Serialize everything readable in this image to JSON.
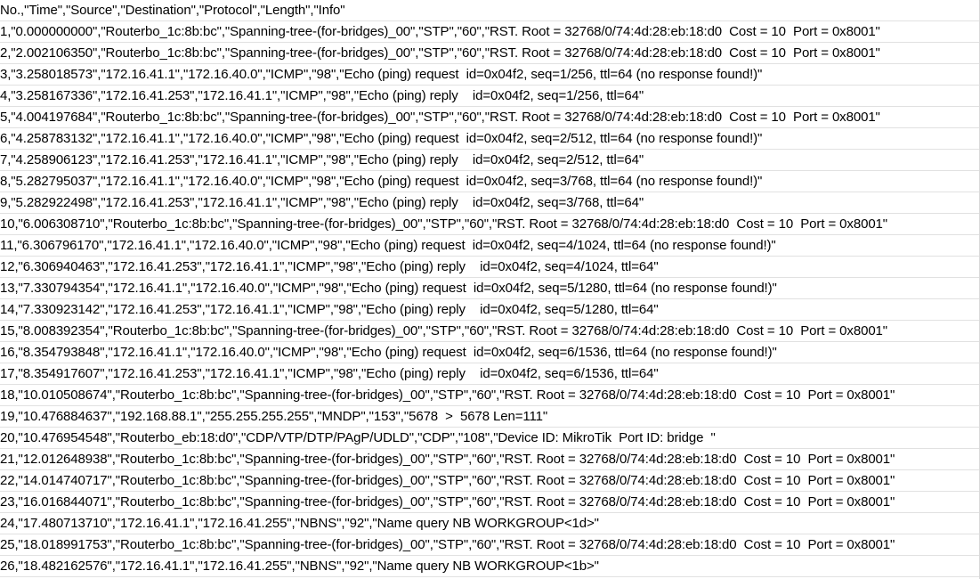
{
  "sheet": {
    "rows": [
      "No.,\"Time\",\"Source\",\"Destination\",\"Protocol\",\"Length\",\"Info\"",
      "1,\"0.000000000\",\"Routerbo_1c:8b:bc\",\"Spanning-tree-(for-bridges)_00\",\"STP\",\"60\",\"RST. Root = 32768/0/74:4d:28:eb:18:d0  Cost = 10  Port = 0x8001\"",
      "2,\"2.002106350\",\"Routerbo_1c:8b:bc\",\"Spanning-tree-(for-bridges)_00\",\"STP\",\"60\",\"RST. Root = 32768/0/74:4d:28:eb:18:d0  Cost = 10  Port = 0x8001\"",
      "3,\"3.258018573\",\"172.16.41.1\",\"172.16.40.0\",\"ICMP\",\"98\",\"Echo (ping) request  id=0x04f2, seq=1/256, ttl=64 (no response found!)\"",
      "4,\"3.258167336\",\"172.16.41.253\",\"172.16.41.1\",\"ICMP\",\"98\",\"Echo (ping) reply    id=0x04f2, seq=1/256, ttl=64\"",
      "5,\"4.004197684\",\"Routerbo_1c:8b:bc\",\"Spanning-tree-(for-bridges)_00\",\"STP\",\"60\",\"RST. Root = 32768/0/74:4d:28:eb:18:d0  Cost = 10  Port = 0x8001\"",
      "6,\"4.258783132\",\"172.16.41.1\",\"172.16.40.0\",\"ICMP\",\"98\",\"Echo (ping) request  id=0x04f2, seq=2/512, ttl=64 (no response found!)\"",
      "7,\"4.258906123\",\"172.16.41.253\",\"172.16.41.1\",\"ICMP\",\"98\",\"Echo (ping) reply    id=0x04f2, seq=2/512, ttl=64\"",
      "8,\"5.282795037\",\"172.16.41.1\",\"172.16.40.0\",\"ICMP\",\"98\",\"Echo (ping) request  id=0x04f2, seq=3/768, ttl=64 (no response found!)\"",
      "9,\"5.282922498\",\"172.16.41.253\",\"172.16.41.1\",\"ICMP\",\"98\",\"Echo (ping) reply    id=0x04f2, seq=3/768, ttl=64\"",
      "10,\"6.006308710\",\"Routerbo_1c:8b:bc\",\"Spanning-tree-(for-bridges)_00\",\"STP\",\"60\",\"RST. Root = 32768/0/74:4d:28:eb:18:d0  Cost = 10  Port = 0x8001\"",
      "11,\"6.306796170\",\"172.16.41.1\",\"172.16.40.0\",\"ICMP\",\"98\",\"Echo (ping) request  id=0x04f2, seq=4/1024, ttl=64 (no response found!)\"",
      "12,\"6.306940463\",\"172.16.41.253\",\"172.16.41.1\",\"ICMP\",\"98\",\"Echo (ping) reply    id=0x04f2, seq=4/1024, ttl=64\"",
      "13,\"7.330794354\",\"172.16.41.1\",\"172.16.40.0\",\"ICMP\",\"98\",\"Echo (ping) request  id=0x04f2, seq=5/1280, ttl=64 (no response found!)\"",
      "14,\"7.330923142\",\"172.16.41.253\",\"172.16.41.1\",\"ICMP\",\"98\",\"Echo (ping) reply    id=0x04f2, seq=5/1280, ttl=64\"",
      "15,\"8.008392354\",\"Routerbo_1c:8b:bc\",\"Spanning-tree-(for-bridges)_00\",\"STP\",\"60\",\"RST. Root = 32768/0/74:4d:28:eb:18:d0  Cost = 10  Port = 0x8001\"",
      "16,\"8.354793848\",\"172.16.41.1\",\"172.16.40.0\",\"ICMP\",\"98\",\"Echo (ping) request  id=0x04f2, seq=6/1536, ttl=64 (no response found!)\"",
      "17,\"8.354917607\",\"172.16.41.253\",\"172.16.41.1\",\"ICMP\",\"98\",\"Echo (ping) reply    id=0x04f2, seq=6/1536, ttl=64\"",
      "18,\"10.010508674\",\"Routerbo_1c:8b:bc\",\"Spanning-tree-(for-bridges)_00\",\"STP\",\"60\",\"RST. Root = 32768/0/74:4d:28:eb:18:d0  Cost = 10  Port = 0x8001\"",
      "19,\"10.476884637\",\"192.168.88.1\",\"255.255.255.255\",\"MNDP\",\"153\",\"5678  >  5678 Len=111\"",
      "20,\"10.476954548\",\"Routerbo_eb:18:d0\",\"CDP/VTP/DTP/PAgP/UDLD\",\"CDP\",\"108\",\"Device ID: MikroTik  Port ID: bridge  \"",
      "21,\"12.012648938\",\"Routerbo_1c:8b:bc\",\"Spanning-tree-(for-bridges)_00\",\"STP\",\"60\",\"RST. Root = 32768/0/74:4d:28:eb:18:d0  Cost = 10  Port = 0x8001\"",
      "22,\"14.014740717\",\"Routerbo_1c:8b:bc\",\"Spanning-tree-(for-bridges)_00\",\"STP\",\"60\",\"RST. Root = 32768/0/74:4d:28:eb:18:d0  Cost = 10  Port = 0x8001\"",
      "23,\"16.016844071\",\"Routerbo_1c:8b:bc\",\"Spanning-tree-(for-bridges)_00\",\"STP\",\"60\",\"RST. Root = 32768/0/74:4d:28:eb:18:d0  Cost = 10  Port = 0x8001\"",
      "24,\"17.480713710\",\"172.16.41.1\",\"172.16.41.255\",\"NBNS\",\"92\",\"Name query NB WORKGROUP<1d>\"",
      "25,\"18.018991753\",\"Routerbo_1c:8b:bc\",\"Spanning-tree-(for-bridges)_00\",\"STP\",\"60\",\"RST. Root = 32768/0/74:4d:28:eb:18:d0  Cost = 10  Port = 0x8001\"",
      "26,\"18.482162576\",\"172.16.41.1\",\"172.16.41.255\",\"NBNS\",\"92\",\"Name query NB WORKGROUP<1b>\""
    ]
  }
}
